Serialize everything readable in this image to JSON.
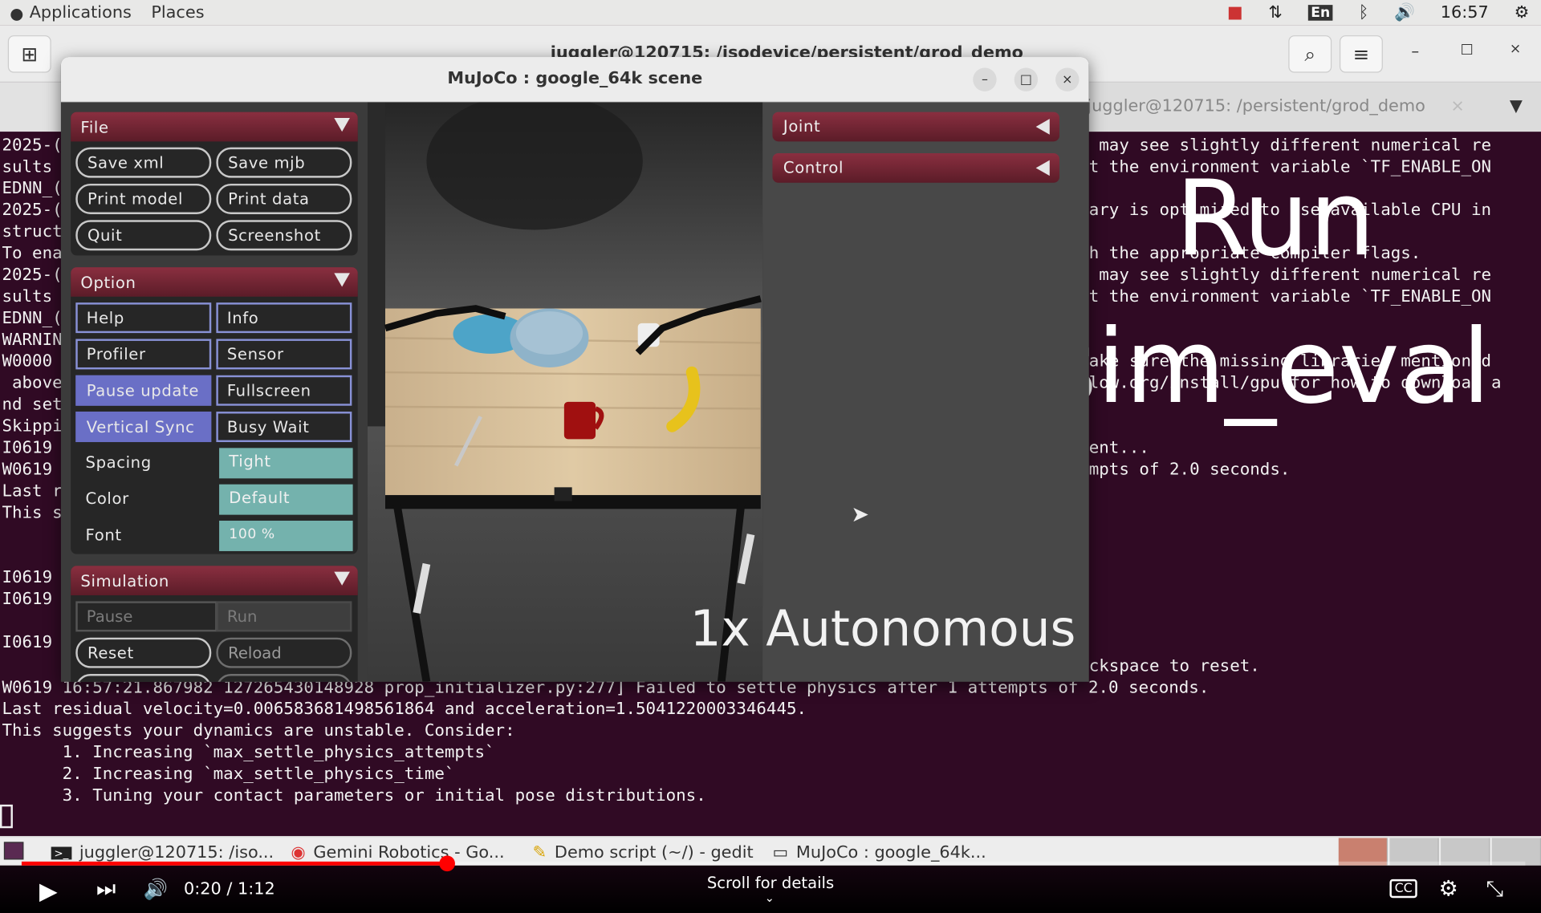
{
  "topbar": {
    "applications": "Applications",
    "places": "Places",
    "language": "En",
    "clock": "16:57"
  },
  "terminal": {
    "title": "juggler@120715: /isodevice/persistent/grod_demo",
    "tab2": "juggler@120715: /persistent/grod_demo",
    "left_lines": [
      "2025-(",
      "sults",
      "EDNN_(",
      "2025-(",
      "struct",
      "To ena",
      "2025-(",
      "sults",
      "EDNN_(",
      "WARNIN",
      "W0000",
      " above",
      "nd set",
      "Skippi",
      "I0619",
      "W0619",
      "Last r",
      "This s",
      "",
      "",
      "I0619",
      "I0619",
      "",
      "I0619"
    ],
    "right_lines": [
      " may see slightly different numerical re",
      "t the environment variable `TF_ENABLE_ON",
      "",
      "ary is optimized to use available CPU in",
      "",
      "h the appropriate compiler flags.",
      " may see slightly different numerical re",
      "t the environment variable `TF_ENABLE_ON",
      "",
      "",
      "ake sure the missing libraries mentioned",
      "low.org/install/gpu for how to download a",
      "",
      "",
      "ent...",
      "mpts of 2.0 seconds."
    ],
    "reset_line": "ckspace to reset.",
    "bottom_lines": [
      "W0619 16:57:21.867982 127265430148928 prop_initializer.py:277] Failed to settle physics after 1 attempts of 2.0 seconds.",
      "Last residual velocity=0.006583681498561864 and acceleration=1.5041220003346445.",
      "This suggests your dynamics are unstable. Consider:",
      "      1. Increasing `max_settle_physics_attempts`",
      "      2. Increasing `max_settle_physics_time`",
      "      3. Tuning your contact parameters or initial pose distributions."
    ]
  },
  "mujoco": {
    "title": "MuJoCo : google_64k scene",
    "file": {
      "header": "File",
      "buttons": [
        "Save xml",
        "Save mjb",
        "Print model",
        "Print data",
        "Quit",
        "Screenshot"
      ]
    },
    "option": {
      "header": "Option",
      "help": "Help",
      "info": "Info",
      "profiler": "Profiler",
      "sensor": "Sensor",
      "pause_update": "Pause update",
      "fullscreen": "Fullscreen",
      "vertical_sync": "Vertical Sync",
      "busy_wait": "Busy Wait",
      "spacing_label": "Spacing",
      "spacing_value": "Tight",
      "color_label": "Color",
      "color_value": "Default",
      "font_label": "Font",
      "font_value": "100 %"
    },
    "simulation": {
      "header": "Simulation",
      "pause": "Pause",
      "run": "Run",
      "reset": "Reset",
      "reload": "Reload"
    },
    "right": {
      "joint": "Joint",
      "control": "Control"
    }
  },
  "overlays": {
    "run": "Run",
    "sim_eval": "sim_eval",
    "autonomous": "1x Autonomous"
  },
  "taskbar": {
    "items": [
      "juggler@120715: /iso...",
      "Gemini Robotics - Go...",
      "Demo script (~/) - gedit",
      "MuJoCo : google_64k..."
    ]
  },
  "video": {
    "time": "0:20 / 1:12",
    "scroll_hint": "Scroll for details",
    "progress": 0.283
  },
  "colors": {
    "terminal_bg": "#300a24",
    "section_header": "#7a2636",
    "checkbox_on": "#6a6fc6",
    "select_bg": "#74b2ad",
    "progress_red": "#ff0000"
  }
}
